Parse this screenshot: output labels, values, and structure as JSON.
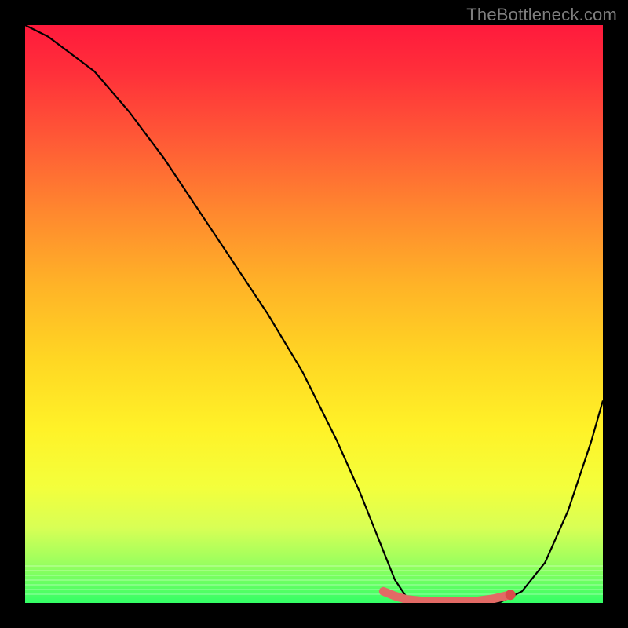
{
  "watermark": "TheBottleneck.com",
  "colors": {
    "frame": "#000000",
    "curve": "#000000",
    "marker": "#e26a65",
    "marker_dot": "#d94a49",
    "gradient_top": "#ff1a3c",
    "gradient_bottom": "#33ff66"
  },
  "chart_data": {
    "type": "line",
    "title": "",
    "xlabel": "",
    "ylabel": "",
    "xlim": [
      0,
      100
    ],
    "ylim": [
      0,
      100
    ],
    "grid": false,
    "series": [
      {
        "name": "bottleneck-curve",
        "x": [
          0,
          4,
          8,
          12,
          18,
          24,
          30,
          36,
          42,
          48,
          54,
          58,
          60,
          62,
          64,
          66,
          70,
          74,
          78,
          82,
          86,
          90,
          94,
          98,
          100
        ],
        "y": [
          100,
          98,
          95,
          92,
          85,
          77,
          68,
          59,
          50,
          40,
          28,
          19,
          14,
          9,
          4,
          1,
          0,
          0,
          0,
          0,
          2,
          7,
          16,
          28,
          35
        ]
      }
    ],
    "highlight_segment": {
      "name": "optimal-range",
      "x": [
        62,
        64,
        66,
        69,
        72,
        75,
        78,
        81,
        84
      ],
      "y": [
        2,
        1.2,
        0.6,
        0.3,
        0.2,
        0.2,
        0.3,
        0.7,
        1.4
      ]
    }
  }
}
